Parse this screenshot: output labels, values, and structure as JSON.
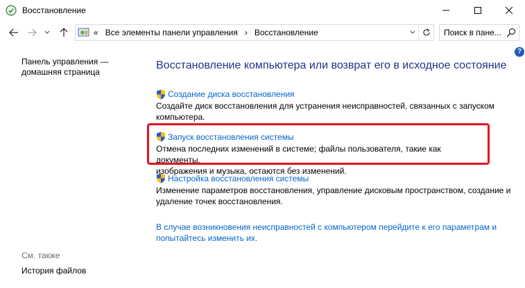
{
  "window": {
    "title": "Восстановление"
  },
  "address": {
    "prefix": "«",
    "crumb1": "Все элементы панели управления",
    "sep": "›",
    "crumb2": "Восстановление"
  },
  "search": {
    "placeholder": "Поиск в пане..."
  },
  "help": {
    "label": "?"
  },
  "sidebar": {
    "home_line1": "Панель управления —",
    "home_line2": "домашняя страница",
    "see_also": "См. также",
    "file_history": "История файлов"
  },
  "main": {
    "title": "Восстановление компьютера или возврат его в исходное состояние",
    "items": [
      {
        "link": "Создание диска восстановления",
        "desc_line1": "Создайте диск восстановления для устранения неисправностей, связанных с запуском",
        "desc_line2": "компьютера."
      },
      {
        "link": "Запуск восстановления системы",
        "desc_line1": "Отмена последних изменений в системе; файлы пользователя, такие как документы,",
        "desc_line2": "изображения и музыка, остаются без изменений."
      },
      {
        "link": "Настройка восстановления системы",
        "desc_line1": "Изменение параметров восстановления, управление дисковым пространством, создание и",
        "desc_line2": "удаление точек восстановления."
      }
    ],
    "bottom_line1": "В случае возникновения неисправностей с компьютером перейдите к его параметрам и",
    "bottom_line2": "попытайтесь изменить их."
  },
  "colors": {
    "link": "#0066cc",
    "title": "#1e3287",
    "highlight": "#e3121e"
  }
}
